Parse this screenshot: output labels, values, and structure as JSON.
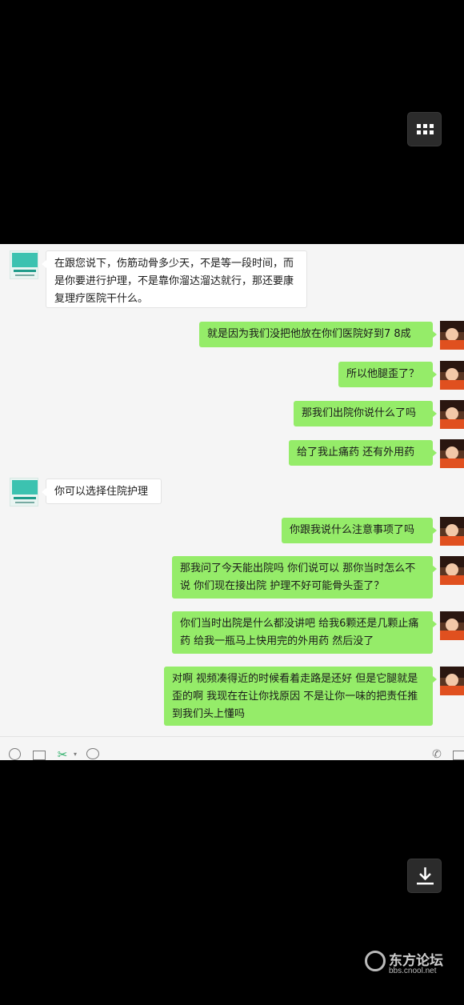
{
  "messages": [
    {
      "side": "in",
      "text": "在跟您说下，伤筋动骨多少天，不是等一段时间，而是你要进行护理，不是靠你溜达溜达就行，那还要康复理疗医院干什么。"
    },
    {
      "side": "out",
      "text": "就是因为我们没把他放在你们医院好到7 8成"
    },
    {
      "side": "out",
      "text": "所以他腿歪了？"
    },
    {
      "side": "out",
      "text": "那我们出院你说什么了吗"
    },
    {
      "side": "out",
      "text": "给了我止痛药 还有外用药"
    },
    {
      "side": "in",
      "text": "你可以选择住院护理"
    },
    {
      "side": "out",
      "text": "你跟我说什么注意事项了吗"
    },
    {
      "side": "out",
      "text": "那我问了今天能出院吗 你们说可以  那你当时怎么不说 你们现在接出院 护理不好可能骨头歪了？"
    },
    {
      "side": "out",
      "text": "你们当时出院是什么都没讲吧 给我6颗还是几颗止痛药 给我一瓶马上快用完的外用药 然后没了"
    },
    {
      "side": "out",
      "text": "对啊 视频凑得近的时候看着走路是还好 但是它腿就是歪的啊 我现在在让你找原因 不是让你一味的把责任推到我们头上懂吗"
    }
  ],
  "watermark": {
    "title": "东方论坛",
    "url": "bbs.cnool.net"
  },
  "icons": [
    "grid-icon",
    "emoji-icon",
    "folder-icon",
    "scissors-icon",
    "chat-icon",
    "phone-icon",
    "download-icon"
  ]
}
